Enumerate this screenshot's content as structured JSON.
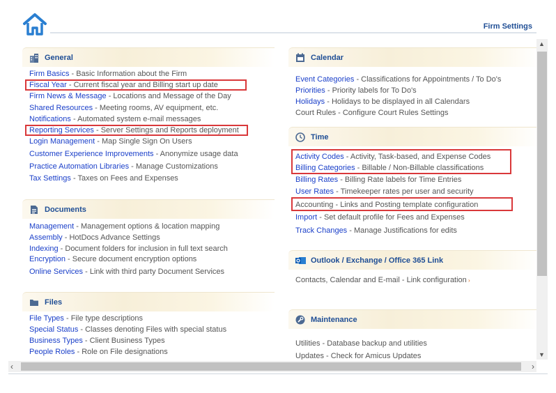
{
  "header": {
    "title": "Firm Settings"
  },
  "icons": {
    "home": "home-icon",
    "general": "building-icon",
    "documents": "document-icon",
    "files": "folder-icon",
    "calendar": "calendar-icon",
    "time": "clock-icon",
    "outlook": "outlook-icon",
    "maintenance": "wrench-icon"
  },
  "colors": {
    "accent": "#1f4e95",
    "link": "#1a3fc9",
    "highlight": "#d9383a",
    "section_bg": "#f7efd9"
  },
  "general": {
    "title": "General",
    "items": [
      {
        "link": "Firm Basics",
        "desc": " - Basic Information about the Firm"
      },
      {
        "link": "Fiscal Year",
        "desc": " - Current fiscal year and Billing start up date"
      },
      {
        "link": "Firm News & Message",
        "desc": " - Locations and Message of the Day"
      },
      {
        "link": "Shared Resources",
        "desc": " - Meeting rooms, AV equipment, etc."
      },
      {
        "link": "Notifications",
        "desc": " - Automated system e-mail messages"
      },
      {
        "link": "Reporting Services",
        "desc": " - Server Settings and Reports deployment"
      },
      {
        "link": "Login Management",
        "desc": " - Map Single Sign On Users"
      },
      {
        "link": "Customer Experience Improvements",
        "desc": " - Anonymize usage data"
      },
      {
        "link": "Practice Automation Libraries",
        "desc": " - Manage Customizations"
      },
      {
        "link": "Tax Settings",
        "desc": " - Taxes on Fees and Expenses"
      }
    ]
  },
  "documents": {
    "title": "Documents",
    "items": [
      {
        "link": "Management",
        "desc": " - Management options & location mapping"
      },
      {
        "link": "Assembly",
        "desc": " - HotDocs Advance Settings"
      },
      {
        "link": "Indexing",
        "desc": " - Document folders for inclusion in full text search"
      },
      {
        "link": "Encryption",
        "desc": " - Secure document encryption options"
      },
      {
        "link": "Online Services",
        "desc": " - Link with third party Document Services"
      }
    ]
  },
  "files": {
    "title": "Files",
    "items": [
      {
        "link": "File Types",
        "desc": " - File type descriptions"
      },
      {
        "link": "Special Status",
        "desc": " - Classes denoting Files with special status"
      },
      {
        "link": "Business Types",
        "desc": " - Client Business Types"
      },
      {
        "link": "People Roles",
        "desc": " - Role on File designations"
      }
    ]
  },
  "calendar": {
    "title": "Calendar",
    "items": [
      {
        "link": "Event Categories",
        "desc": " - Classifications for Appointments / To Do's"
      },
      {
        "link": "Priorities",
        "desc": " - Priority labels for To Do's"
      },
      {
        "link": "Holidays",
        "desc": " - Holidays to be displayed in all Calendars"
      },
      {
        "link": "",
        "desc": "Court Rules - Configure Court Rules Settings"
      }
    ]
  },
  "time": {
    "title": "Time",
    "items": [
      {
        "link": "Activity Codes",
        "desc": " - Activity, Task-based, and Expense Codes"
      },
      {
        "link": "Billing Categories",
        "desc": " - Billable / Non-Billable classifications"
      },
      {
        "link": "Billing Rates",
        "desc": " - Billing Rate labels for Time Entries"
      },
      {
        "link": "User Rates",
        "desc": " - Timekeeper rates per user and security"
      },
      {
        "link": "",
        "desc": "Accounting - Links and Posting template configuration"
      },
      {
        "link": "Import",
        "desc": " - Set default profile for Fees and Expenses"
      },
      {
        "link": "Track Changes",
        "desc": "  - Manage Justifications for edits"
      }
    ]
  },
  "outlook": {
    "title": "Outlook / Exchange / Office 365 Link",
    "items": [
      {
        "link": "",
        "desc": "Contacts, Calendar and E-mail - Link configuration"
      }
    ]
  },
  "maintenance": {
    "title": "Maintenance",
    "items": [
      {
        "link": "",
        "desc": "Utilities - Database backup and utilities"
      },
      {
        "link": "",
        "desc": "Updates - Check for Amicus Updates"
      }
    ]
  }
}
